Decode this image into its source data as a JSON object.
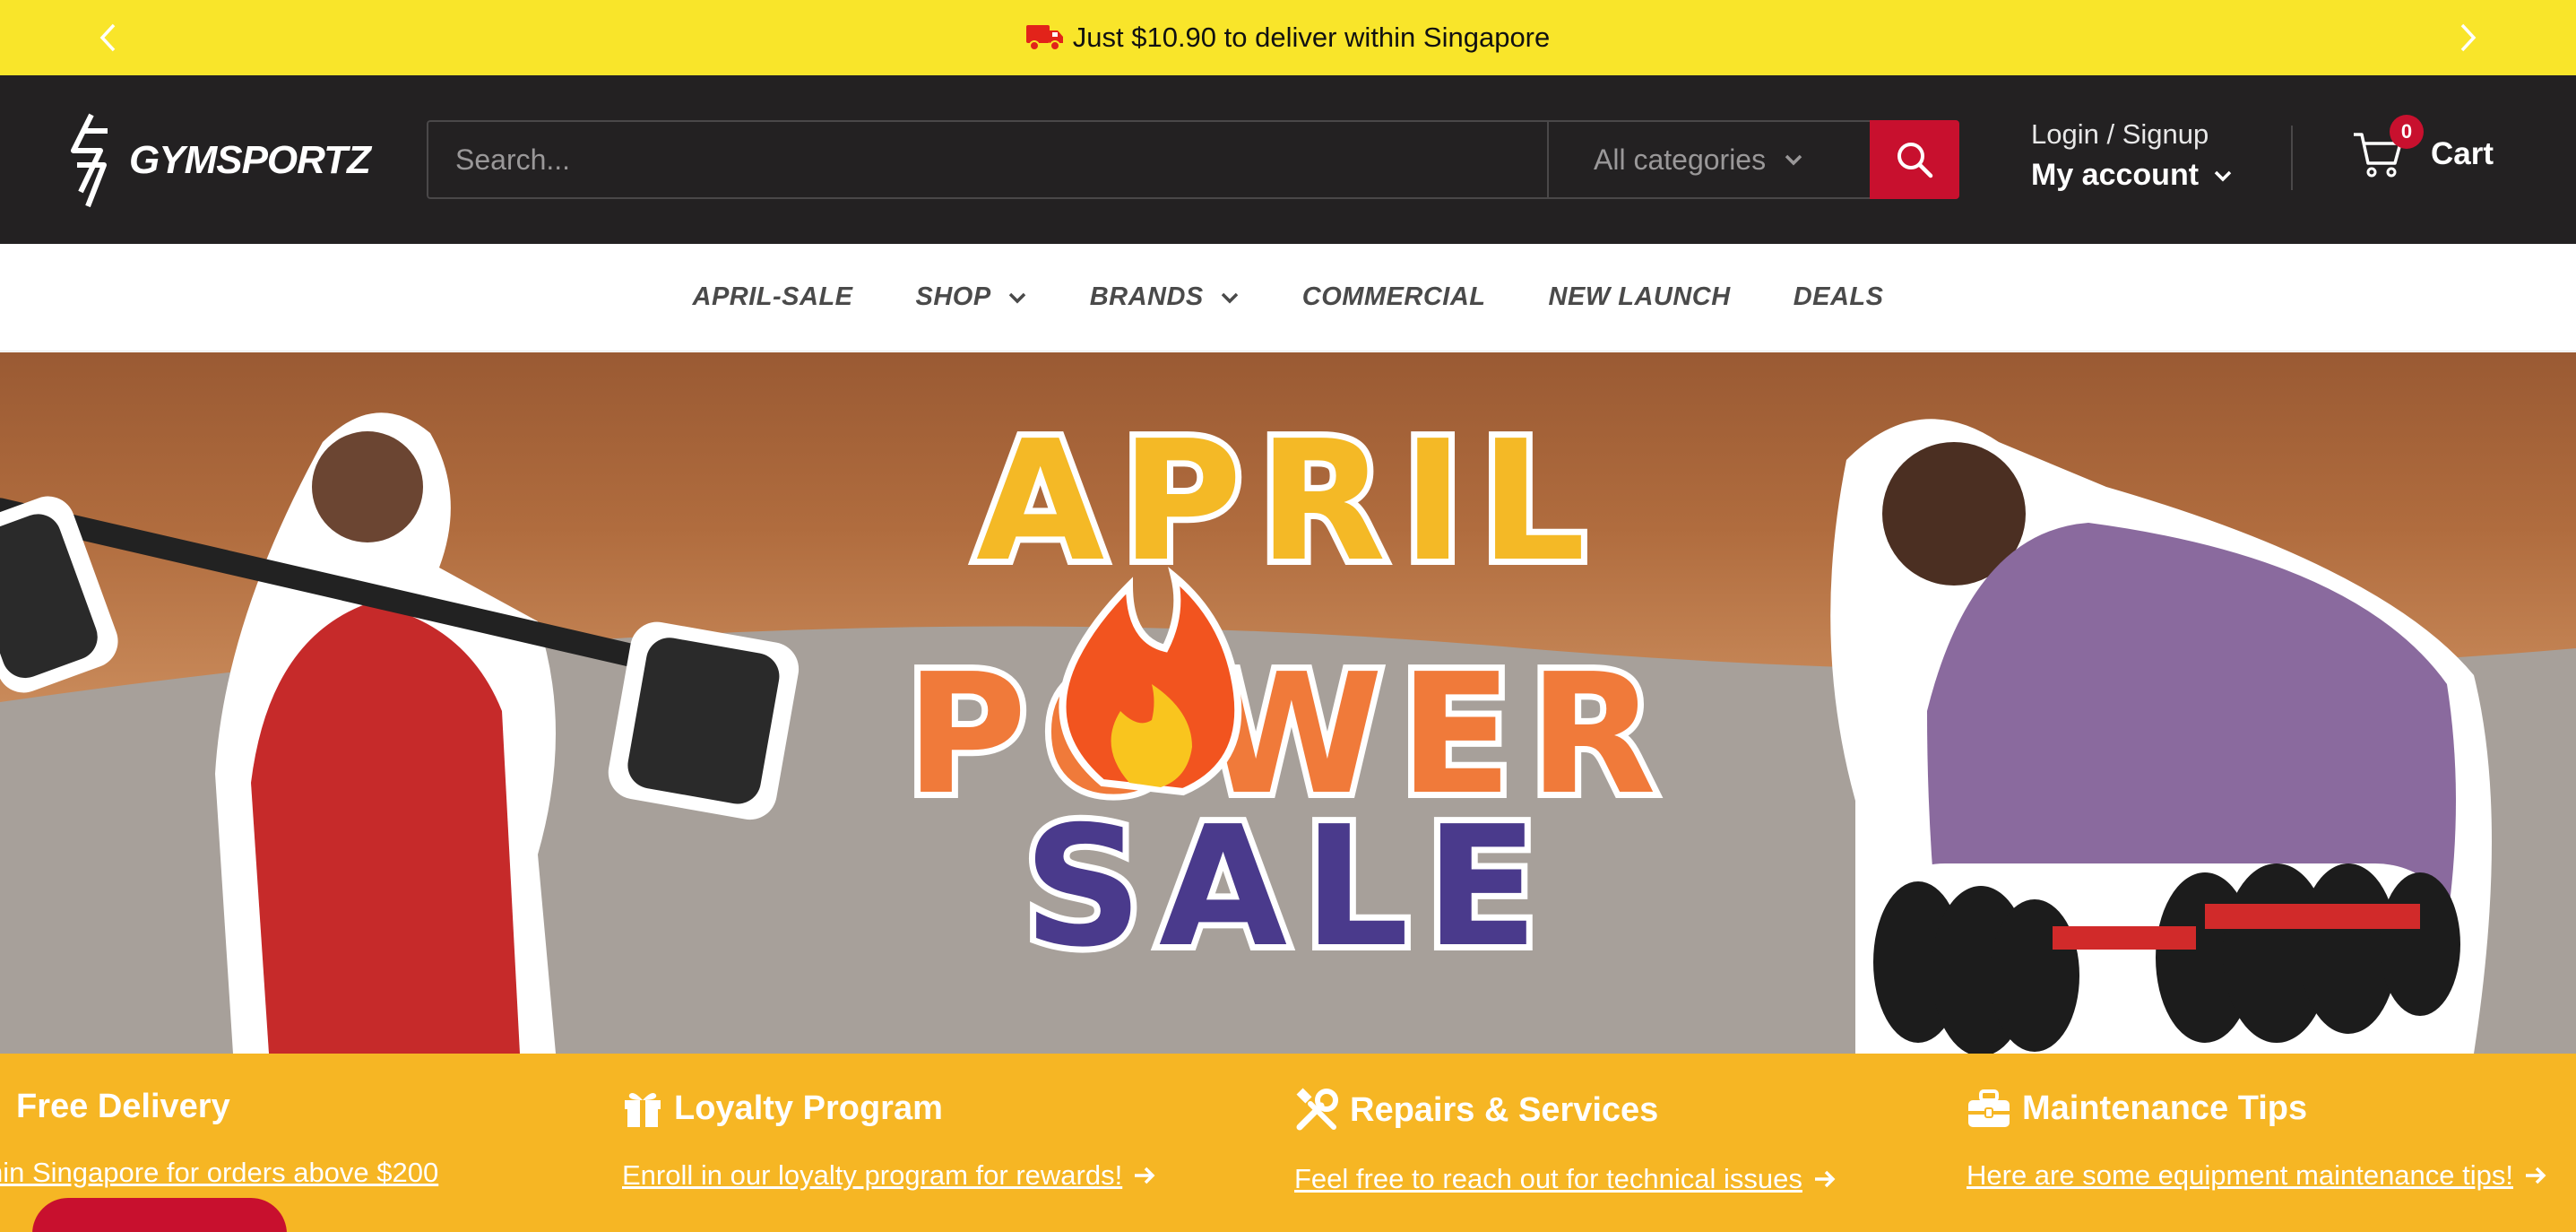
{
  "announcement": {
    "message": "Just $10.90 to deliver within Singapore",
    "icon": "truck-icon",
    "prev_icon": "chevron-left-icon",
    "next_icon": "chevron-right-icon"
  },
  "header": {
    "logo_text": "GYMSPORTZ",
    "search": {
      "placeholder": "Search...",
      "category_selected": "All categories"
    },
    "account": {
      "login_label": "Login / Signup",
      "my_account_label": "My account"
    },
    "cart": {
      "label": "Cart",
      "count": "0"
    }
  },
  "nav": {
    "items": [
      {
        "label": "APRIL-SALE",
        "has_dropdown": false
      },
      {
        "label": "SHOP",
        "has_dropdown": true
      },
      {
        "label": "BRANDS",
        "has_dropdown": true
      },
      {
        "label": "COMMERCIAL",
        "has_dropdown": false
      },
      {
        "label": "NEW LAUNCH",
        "has_dropdown": false
      },
      {
        "label": "DEALS",
        "has_dropdown": false
      }
    ]
  },
  "hero": {
    "line1": "APRIL",
    "line2": "POWER",
    "line3": "SALE"
  },
  "features": [
    {
      "title": "Free Delivery",
      "link": "hin Singapore for orders above $200",
      "icon": "truck-icon"
    },
    {
      "title": "Loyalty Program",
      "link": "Enroll in our loyalty program for rewards!",
      "icon": "gift-icon"
    },
    {
      "title": "Repairs & Services",
      "link": "Feel free to reach out for technical issues",
      "icon": "tools-icon"
    },
    {
      "title": "Maintenance Tips",
      "link": "Here are some equipment maintenance tips!",
      "icon": "toolbox-icon"
    }
  ],
  "colors": {
    "announce_bg": "#f9e52a",
    "header_bg": "#232122",
    "accent_red": "#c8102e",
    "features_bg": "#f6b624",
    "hero_yellow": "#f4b926",
    "hero_orange": "#f07a3a",
    "hero_purple": "#4a3a8c"
  }
}
